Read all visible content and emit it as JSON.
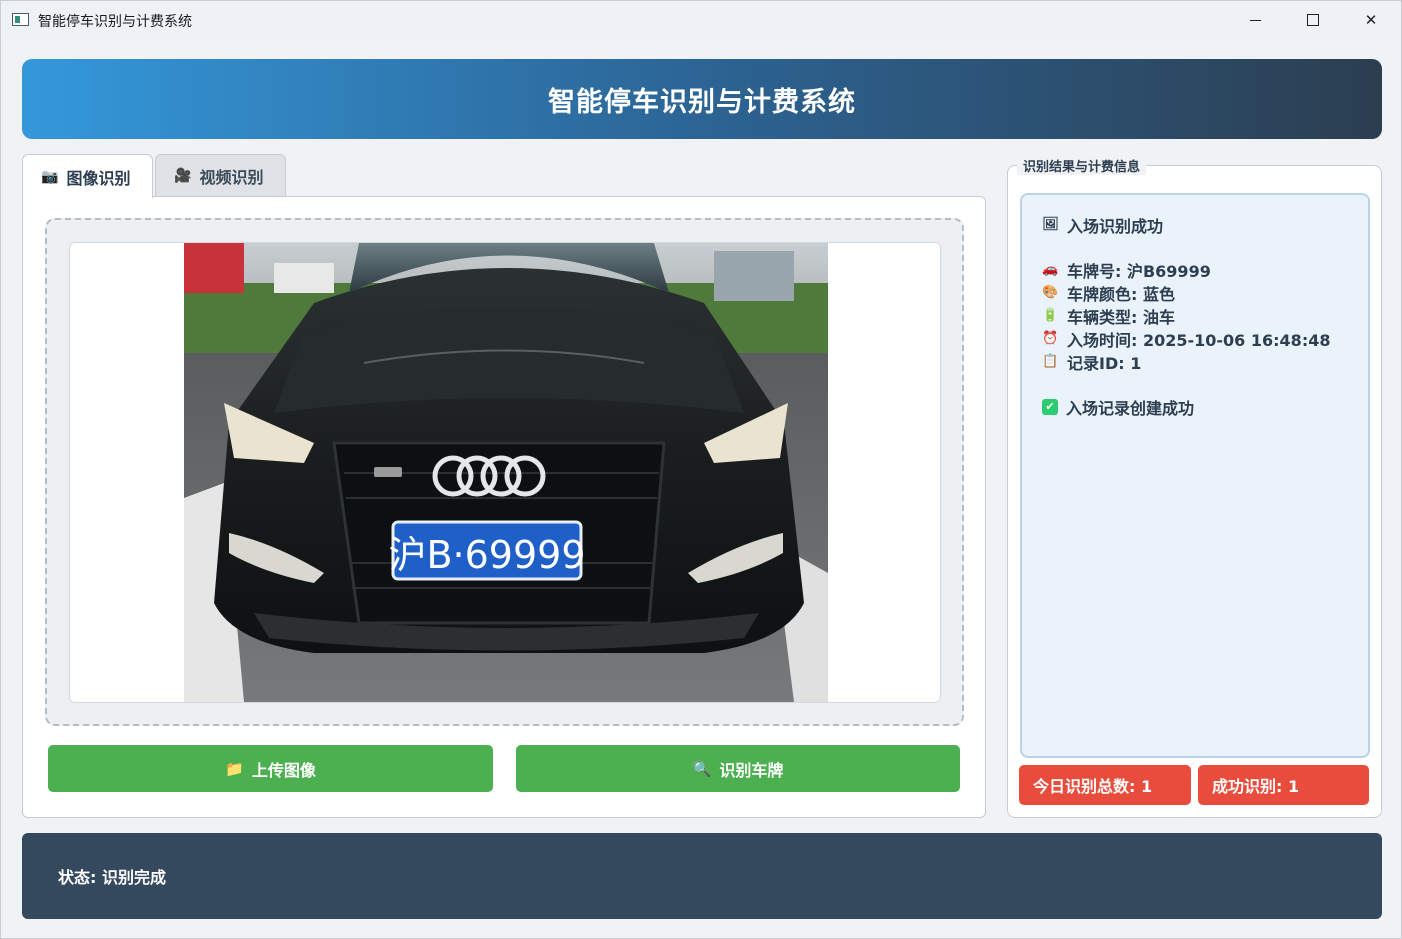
{
  "window": {
    "title": "智能停车识别与计费系统",
    "controls": {
      "minimize": "",
      "maximize": "",
      "close": "✕"
    }
  },
  "header": {
    "title": "智能停车识别与计费系统"
  },
  "tabs": [
    {
      "label": "图像识别",
      "icon": "camera-icon",
      "glyph": "📷",
      "active": true
    },
    {
      "label": "视频识别",
      "icon": "video-camera-icon",
      "glyph": "🎥",
      "active": false
    }
  ],
  "image_panel": {
    "photo": {
      "plate_text": "沪B·69999"
    }
  },
  "buttons": {
    "upload": {
      "label": "上传图像",
      "icon": "folder-icon",
      "glyph": "📁"
    },
    "recognize": {
      "label": "识别车牌",
      "icon": "magnifier-icon",
      "glyph": "🔍"
    }
  },
  "result_group": {
    "title": "识别结果与计费信息",
    "status_line": {
      "text": "入场识别成功",
      "icon": "picture-icon",
      "glyph": "🖼"
    },
    "details": [
      {
        "text": "车牌号: 沪B69999",
        "icon": "car-icon",
        "glyph": "🚗"
      },
      {
        "text": "车牌颜色: 蓝色",
        "icon": "palette-icon",
        "glyph": "🎨"
      },
      {
        "text": "车辆类型: 油车",
        "icon": "battery-icon",
        "glyph": "🔋"
      },
      {
        "text": "入场时间: 2025-10-06 16:48:48",
        "icon": "alarm-clock-icon",
        "glyph": "⏰"
      },
      {
        "text": "记录ID: 1",
        "icon": "clipboard-icon",
        "glyph": "📋"
      }
    ],
    "confirm_line": {
      "text": "入场记录创建成功",
      "icon": "check-box-icon",
      "glyph": "✔"
    }
  },
  "stats": {
    "total": "今日识别总数: 1",
    "success": "成功识别: 1"
  },
  "statusbar": {
    "text": "状态: 识别完成"
  },
  "colors": {
    "header_start": "#3498db",
    "header_end": "#2c3e50",
    "button_green": "#4caf50",
    "stat_red": "#e74c3c",
    "statusbar_bg": "#34495e",
    "result_bg": "#eaf3fb"
  }
}
